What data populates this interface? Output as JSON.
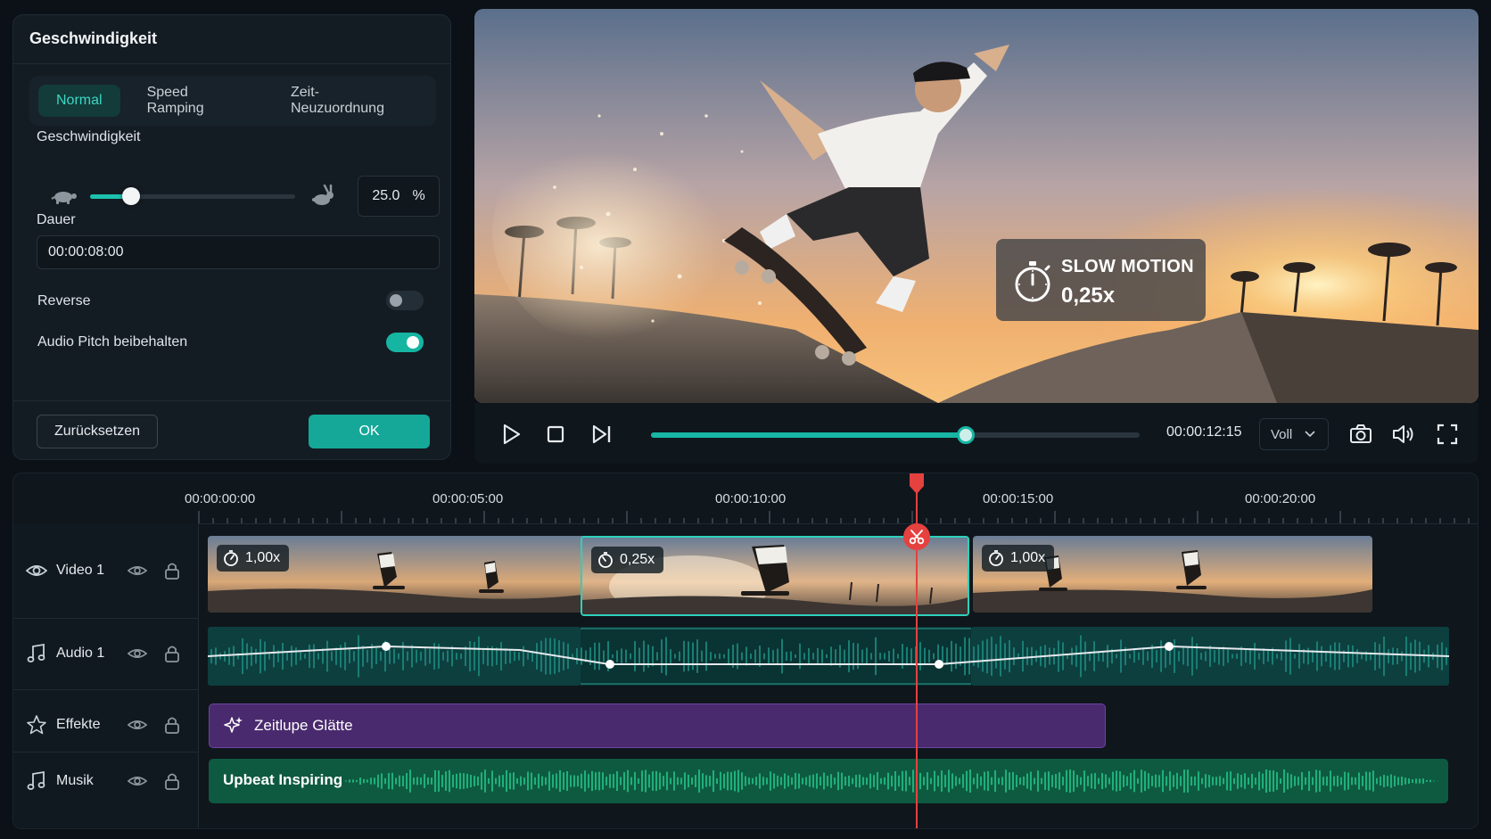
{
  "speed_panel": {
    "title": "Geschwindigkeit",
    "tabs": [
      {
        "label": "Normal",
        "active": true
      },
      {
        "label": "Speed Ramping",
        "active": false
      },
      {
        "label": "Zeit-Neuzuordnung",
        "active": false
      }
    ],
    "speed_label": "Geschwindigkeit",
    "speed_slider_fraction": 0.2,
    "speed_value": "25.0",
    "speed_unit": "%",
    "duration_label": "Dauer",
    "duration_value": "00:00:08:00",
    "reverse_label": "Reverse",
    "reverse_on": false,
    "audio_pitch_label": "Audio Pitch beibehalten",
    "audio_pitch_on": true,
    "reset_label": "Zurücksetzen",
    "ok_label": "OK"
  },
  "preview": {
    "badge_title": "SLOW MOTION",
    "badge_value": "0,25x"
  },
  "player": {
    "progress_fraction": 0.645,
    "time": "00:00:12:15",
    "quality": "Voll"
  },
  "timeline": {
    "ruler_labels": [
      "00:00:00:00",
      "00:00:05:00",
      "00:00:10:00",
      "00:00:15:00",
      "00:00:20:00"
    ],
    "tracks": [
      {
        "name": "Video 1",
        "icon": "eye-icon"
      },
      {
        "name": "Audio 1",
        "icon": "music-note-icon"
      },
      {
        "name": "Effekte",
        "icon": "star-icon"
      },
      {
        "name": "Musik",
        "icon": "music-note-icon"
      }
    ],
    "video_clips": [
      {
        "speed": "1,00x"
      },
      {
        "speed": "0,25x"
      },
      {
        "speed": "1,00x"
      }
    ],
    "effect_clip": "Zeitlupe Glätte",
    "music_clip": "Upbeat Inspiring"
  },
  "colors": {
    "accent": "#15a899",
    "playhead": "#e5413f",
    "effect": "#4a2a6e",
    "music": "#0e5a41"
  }
}
